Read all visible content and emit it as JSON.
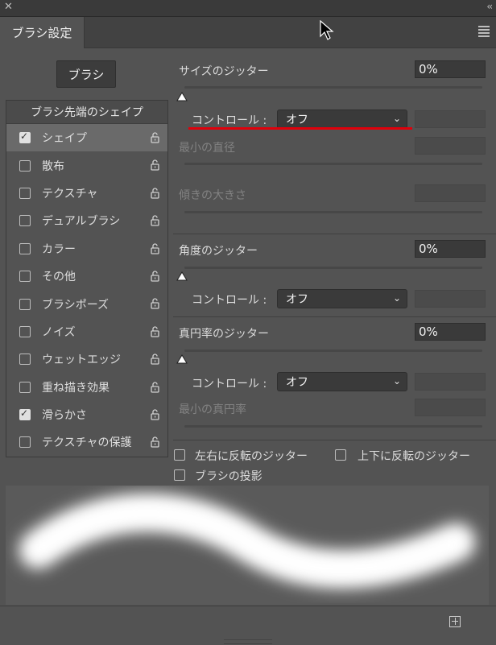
{
  "panel": {
    "close_glyph": "✕",
    "collapse_glyph": "‹‹",
    "tab_label": "ブラシ設定"
  },
  "left": {
    "brush_button": "ブラシ",
    "list_header": "ブラシ先端のシェイプ",
    "items": [
      {
        "label": "シェイプ",
        "checked": true,
        "selected": true
      },
      {
        "label": "散布",
        "checked": false
      },
      {
        "label": "テクスチャ",
        "checked": false
      },
      {
        "label": "デュアルブラシ",
        "checked": false
      },
      {
        "label": "カラー",
        "checked": false
      },
      {
        "label": "その他",
        "checked": false
      },
      {
        "label": "ブラシポーズ",
        "checked": false
      },
      {
        "label": "ノイズ",
        "checked": false
      },
      {
        "label": "ウェットエッジ",
        "checked": false
      },
      {
        "label": "重ね描き効果",
        "checked": false
      },
      {
        "label": "滑らかさ",
        "checked": true
      },
      {
        "label": "テクスチャの保護",
        "checked": false
      }
    ]
  },
  "size": {
    "label": "サイズのジッター",
    "value": "0%",
    "control_label": "コントロール :",
    "control_value": "オフ",
    "min_diameter_label": "最小の直径",
    "tilt_scale_label": "傾きの大きさ"
  },
  "angle": {
    "label": "角度のジッター",
    "value": "0%",
    "control_label": "コントロール :",
    "control_value": "オフ"
  },
  "roundness": {
    "label": "真円率のジッター",
    "value": "0%",
    "control_label": "コントロール :",
    "control_value": "オフ",
    "min_roundness_label": "最小の真円率"
  },
  "options": {
    "flip_x": "左右に反転のジッター",
    "flip_y": "上下に反転のジッター",
    "projection": "ブラシの投影"
  },
  "colors": {
    "highlight": "#e0000b",
    "panel_bg": "#535353"
  }
}
